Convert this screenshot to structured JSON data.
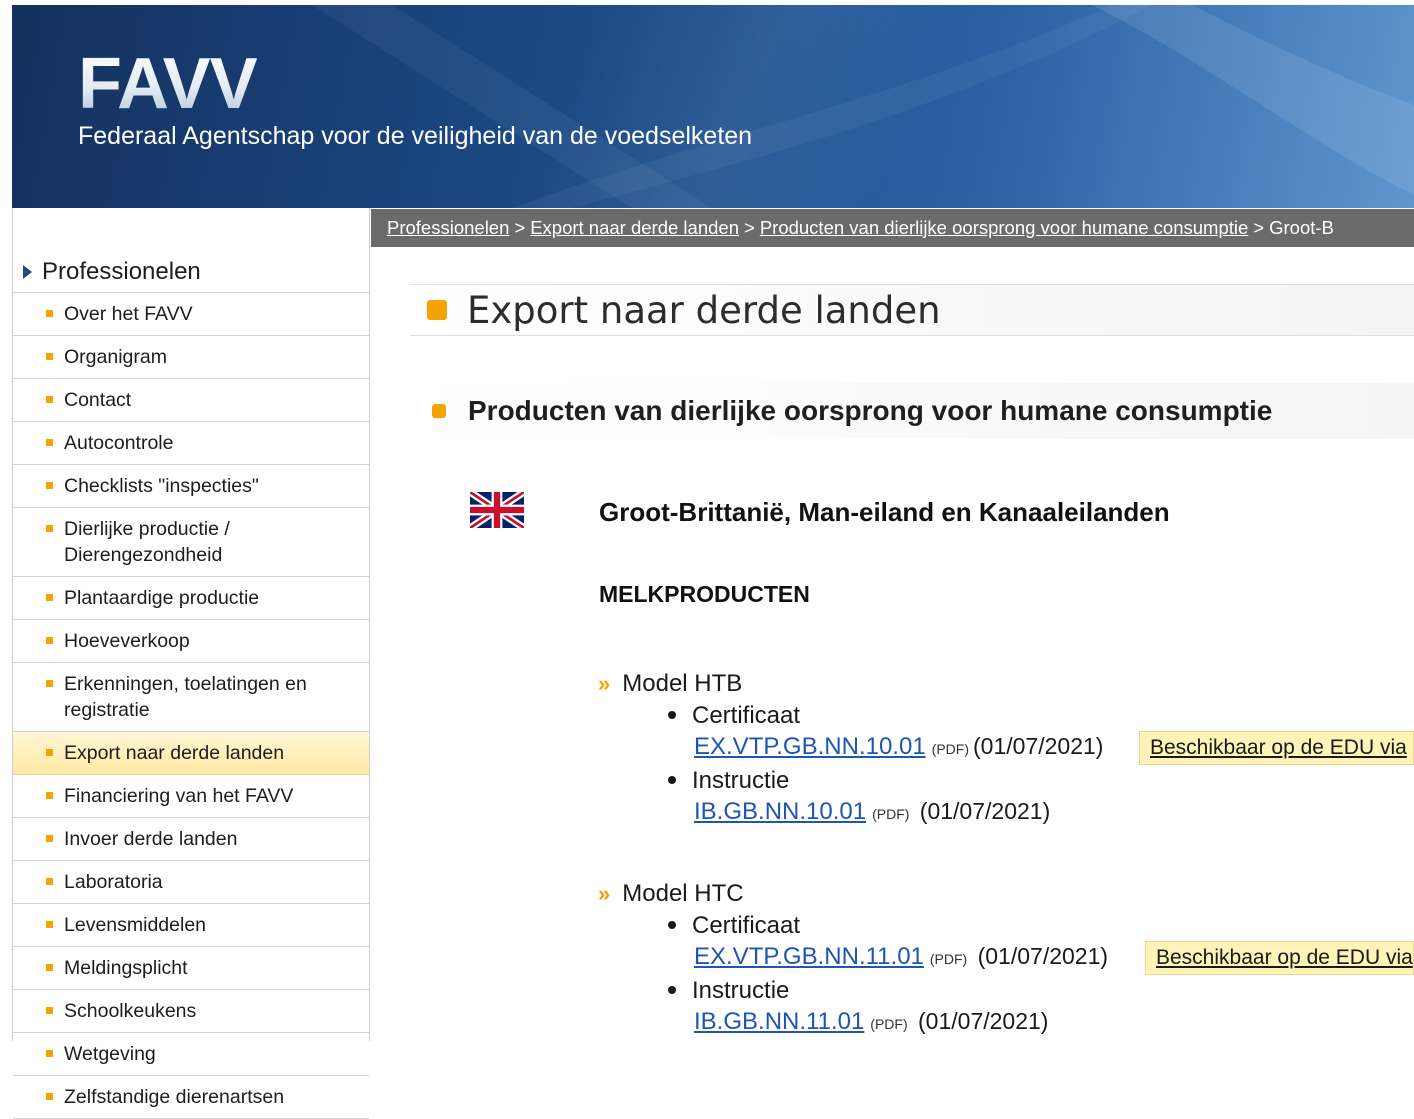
{
  "header": {
    "logo": "FAVV",
    "tagline": "Federaal Agentschap voor de veiligheid van de voedselketen"
  },
  "sidebar": {
    "heading": "Professionelen",
    "items": [
      {
        "label": "Over het FAVV"
      },
      {
        "label": "Organigram"
      },
      {
        "label": "Contact"
      },
      {
        "label": "Autocontrole"
      },
      {
        "label": "Checklists \"inspecties\""
      },
      {
        "label": "Dierlijke productie / Dierengezondheid"
      },
      {
        "label": "Plantaardige productie"
      },
      {
        "label": "Hoeveverkoop"
      },
      {
        "label": "Erkenningen, toelatingen en registratie"
      },
      {
        "label": "Export naar derde landen",
        "active": true
      },
      {
        "label": "Financiering van het FAVV"
      },
      {
        "label": "Invoer derde landen"
      },
      {
        "label": "Laboratoria"
      },
      {
        "label": "Levensmiddelen"
      },
      {
        "label": "Meldingsplicht"
      },
      {
        "label": "Schoolkeukens"
      },
      {
        "label": "Wetgeving"
      },
      {
        "label": "Zelfstandige dierenartsen"
      }
    ]
  },
  "breadcrumb": {
    "items": [
      "Professionelen",
      "Export naar derde landen",
      "Producten van dierlijke oorsprong voor humane consumptie"
    ],
    "current": "Groot-B",
    "separator": ">"
  },
  "main": {
    "page_title": "Export naar derde landen",
    "section_title": "Producten van dierlijke oorsprong voor humane consumptie",
    "country": "Groot-Brittanië, Man-eiland en Kanaaleilanden",
    "category": "MELKPRODUCTEN",
    "models": [
      {
        "name": "Model HTB",
        "certificate_label": "Certificaat",
        "certificate_link": "EX.VTP.GB.NN.10.01",
        "certificate_format": "(PDF)",
        "certificate_date": "(01/07/2021)",
        "edu_label": "Beschikbaar op de EDU via",
        "instruction_label": "Instructie",
        "instruction_link": "IB.GB.NN.10.01",
        "instruction_format": "(PDF)",
        "instruction_date": "(01/07/2021)"
      },
      {
        "name": "Model HTC",
        "certificate_label": "Certificaat",
        "certificate_link": "EX.VTP.GB.NN.11.01",
        "certificate_format": "(PDF)",
        "certificate_date": "(01/07/2021)",
        "edu_label": "Beschikbaar op de EDU via",
        "instruction_label": "Instructie",
        "instruction_link": "IB.GB.NN.11.01",
        "instruction_format": "(PDF)",
        "instruction_date": "(01/07/2021)"
      }
    ]
  },
  "colors": {
    "accent_orange": "#f5a300",
    "banner_blue": "#1c4a86",
    "link_blue": "#1f55b4",
    "active_item_bg": "#ffe9a3",
    "breadcrumb_bg": "#6b6b6b"
  },
  "icons": {
    "flag": "uk-flag-icon",
    "sidebar_bullet": "orange-square-bullet",
    "model_bullet": "double-chevron-right"
  }
}
